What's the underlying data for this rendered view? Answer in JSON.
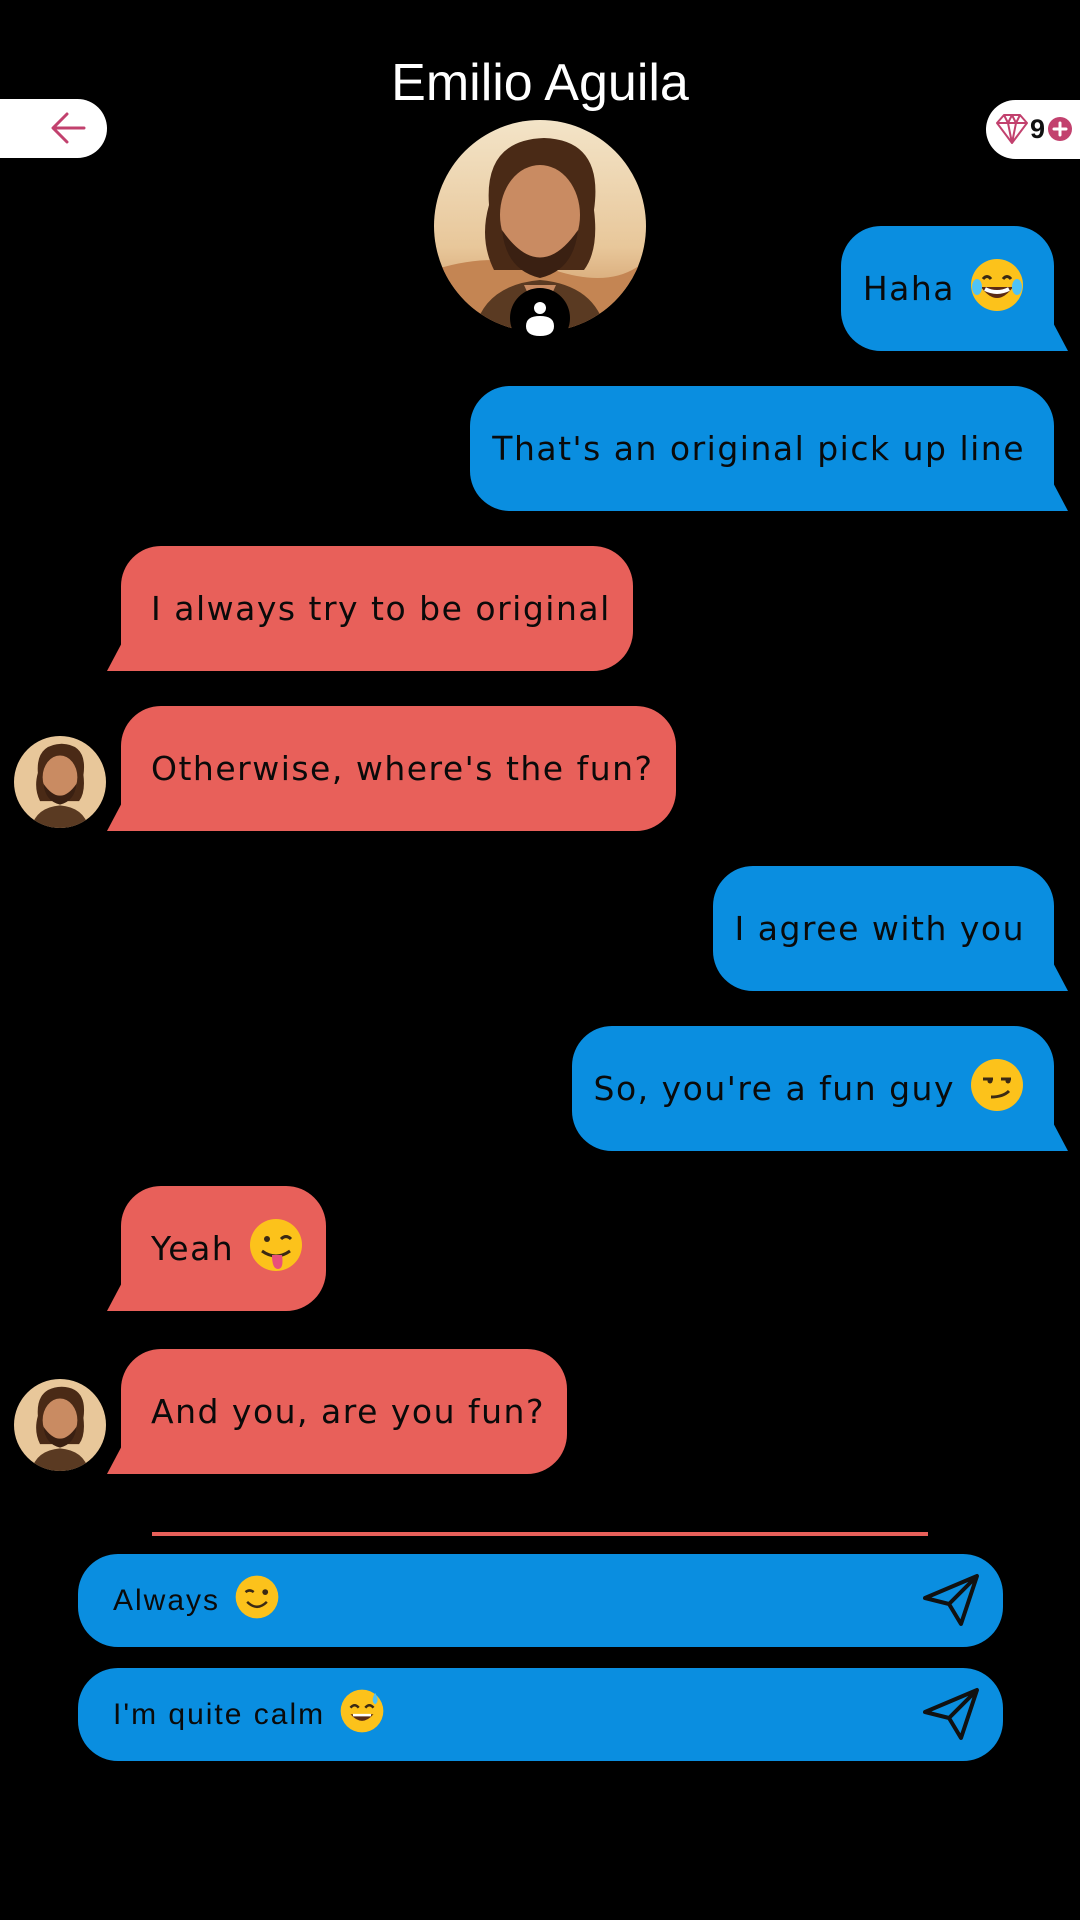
{
  "header": {
    "title": "Emilio Aguila"
  },
  "gems": {
    "count": "9"
  },
  "colors": {
    "sent": "#0a8ee0",
    "received": "#e8605a",
    "accent": "#c2416e"
  },
  "messages": [
    {
      "from": "user",
      "text": "Haha",
      "emoji": "laughing-emoji"
    },
    {
      "from": "user",
      "text": "That's an original pick up line"
    },
    {
      "from": "contact",
      "text": "I always try to be original"
    },
    {
      "from": "contact",
      "text": "Otherwise, where's the fun?"
    },
    {
      "from": "user",
      "text": "I agree with you"
    },
    {
      "from": "user",
      "text": "So, you're a fun guy",
      "emoji": "smirk-emoji"
    },
    {
      "from": "contact",
      "text": "Yeah",
      "emoji": "winking-tongue-emoji"
    },
    {
      "from": "contact",
      "text": "And you, are you fun?"
    }
  ],
  "replies": [
    {
      "text": "Always",
      "emoji": "wink-emoji"
    },
    {
      "text": "I'm quite calm",
      "emoji": "sweat-smile-emoji"
    }
  ]
}
